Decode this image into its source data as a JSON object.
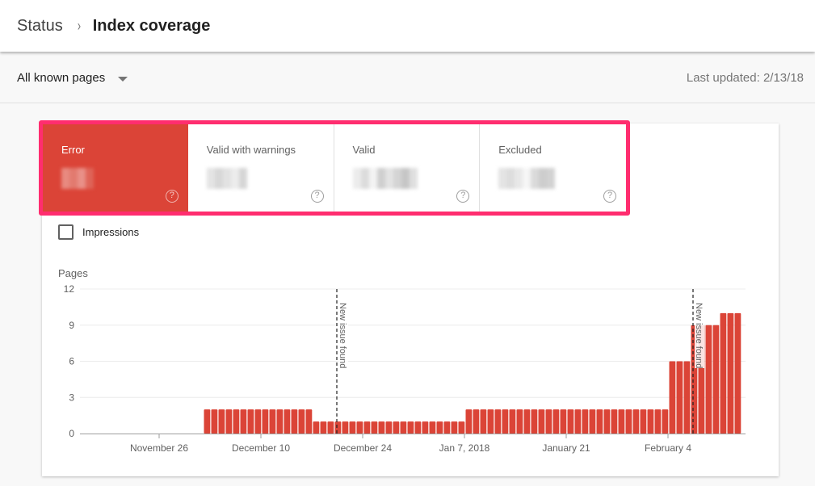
{
  "header": {
    "breadcrumb_root": "Status",
    "breadcrumb_separator": "›",
    "title": "Index coverage"
  },
  "toolbar": {
    "filter_value": "All known pages",
    "last_updated": "Last updated: 2/13/18"
  },
  "tiles": [
    {
      "label": "Error",
      "value": "redacted",
      "selected": true,
      "help_icon": "help-circle-icon"
    },
    {
      "label": "Valid with warnings",
      "value": "redacted",
      "selected": false,
      "help_icon": "help-circle-icon"
    },
    {
      "label": "Valid",
      "value": "redacted",
      "selected": false,
      "help_icon": "help-circle-icon"
    },
    {
      "label": "Excluded",
      "value": "redacted",
      "selected": false,
      "help_icon": "help-circle-icon"
    }
  ],
  "impressions": {
    "label": "Impressions",
    "checked": false
  },
  "colors": {
    "error": "#db4437",
    "highlight_outline": "#ff2d6f"
  },
  "chart_data": {
    "type": "bar",
    "title": "",
    "xlabel": "",
    "ylabel": "Pages",
    "ylim": [
      0,
      12
    ],
    "yticks": [
      0,
      3,
      6,
      9,
      12
    ],
    "grid": true,
    "x_range": [
      "2017-11-15",
      "2018-02-13"
    ],
    "xtick_labels": [
      {
        "date": "2017-11-26",
        "label": "November 26"
      },
      {
        "date": "2017-12-10",
        "label": "December 10"
      },
      {
        "date": "2017-12-24",
        "label": "December 24"
      },
      {
        "date": "2018-01-07",
        "label": "Jan 7, 2018"
      },
      {
        "date": "2018-01-21",
        "label": "January 21"
      },
      {
        "date": "2018-02-04",
        "label": "February 4"
      }
    ],
    "series": [
      {
        "name": "Error",
        "color": "#db4437",
        "points": [
          {
            "start": "2017-12-02",
            "days": 15,
            "value": 2
          },
          {
            "start": "2017-12-17",
            "days": 21,
            "value": 1
          },
          {
            "start": "2018-01-07",
            "days": 28,
            "value": 2
          },
          {
            "start": "2018-02-04",
            "days": 3,
            "value": 6
          },
          {
            "start": "2018-02-07",
            "days": 4,
            "value": 9
          },
          {
            "start": "2018-02-11",
            "days": 3,
            "value": 10
          }
        ]
      }
    ],
    "annotations": [
      {
        "date": "2017-12-20",
        "label": "New issue found"
      },
      {
        "date": "2018-02-07",
        "label": "New issue found"
      }
    ]
  }
}
